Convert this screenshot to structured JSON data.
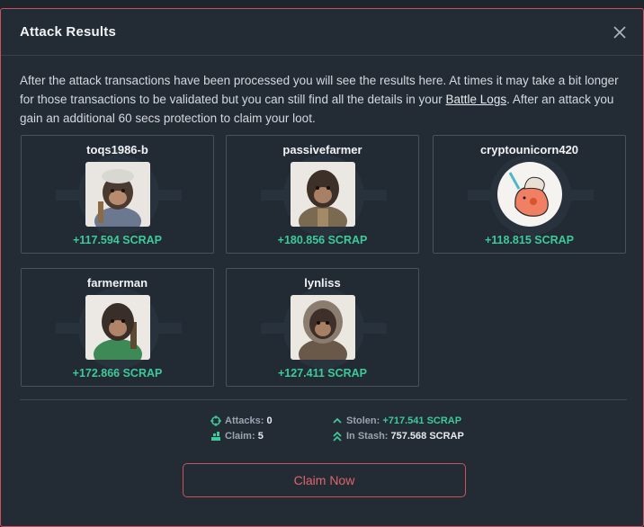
{
  "modal": {
    "title": "Attack Results",
    "intro_before_link": "After the attack transactions have been processed you will see the results here. At times it may take a bit longer for those transactions to be validated but you can still find all the details in your ",
    "link_text": "Battle Logs",
    "intro_after_link": ". After an attack you gain an additional 60 secs protection to claim your loot."
  },
  "results": [
    {
      "name": "toqs1986-b",
      "loot": "+117.594 SCRAP",
      "avatar": "ape-mechanic-icon"
    },
    {
      "name": "passivefarmer",
      "loot": "+180.856 SCRAP",
      "avatar": "ape-farmer-icon"
    },
    {
      "name": "cryptounicorn420",
      "loot": "+118.815 SCRAP",
      "avatar": "unicorn-icon"
    },
    {
      "name": "farmerman",
      "loot": "+172.866 SCRAP",
      "avatar": "ape-green-jacket-icon"
    },
    {
      "name": "lynliss",
      "loot": "+127.411 SCRAP",
      "avatar": "ape-hooded-icon"
    }
  ],
  "stats": {
    "attacks_label": "Attacks:",
    "attacks_value": "0",
    "claim_label": "Claim:",
    "claim_value": "5",
    "stolen_label": "Stolen:",
    "stolen_value": "+717.541 SCRAP",
    "stash_label": "In Stash:",
    "stash_value": "757.568 SCRAP"
  },
  "claim_button": "Claim Now",
  "colors": {
    "accent": "#c9525c",
    "loot_green": "#3ec99a",
    "panel": "#232c35"
  }
}
